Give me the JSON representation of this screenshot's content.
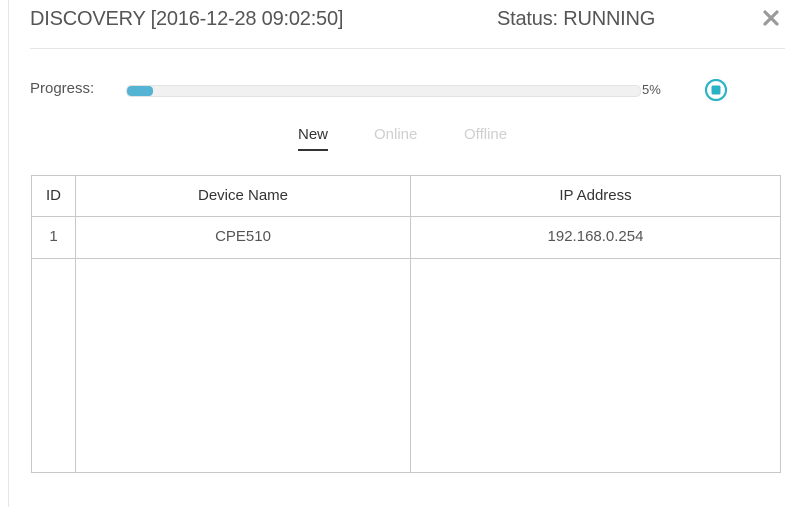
{
  "dialog": {
    "title": "DISCOVERY [2016-12-28 09:02:50]",
    "status": "Status: RUNNING",
    "close_icon": "close-icon"
  },
  "progress": {
    "label": "Progress:",
    "value_percent": 5,
    "text": "5%",
    "stop_icon": "stop-circle-icon",
    "fill_color": "#55b3d3",
    "accent_color": "#2bb3c5"
  },
  "tabs": [
    {
      "label": "New",
      "active": true
    },
    {
      "label": "Online",
      "active": false
    },
    {
      "label": "Offline",
      "active": false
    }
  ],
  "table": {
    "columns": [
      "ID",
      "Device Name",
      "IP Address"
    ],
    "rows": [
      {
        "id": "1",
        "device_name": "CPE510",
        "ip_address": "192.168.0.254"
      }
    ]
  }
}
